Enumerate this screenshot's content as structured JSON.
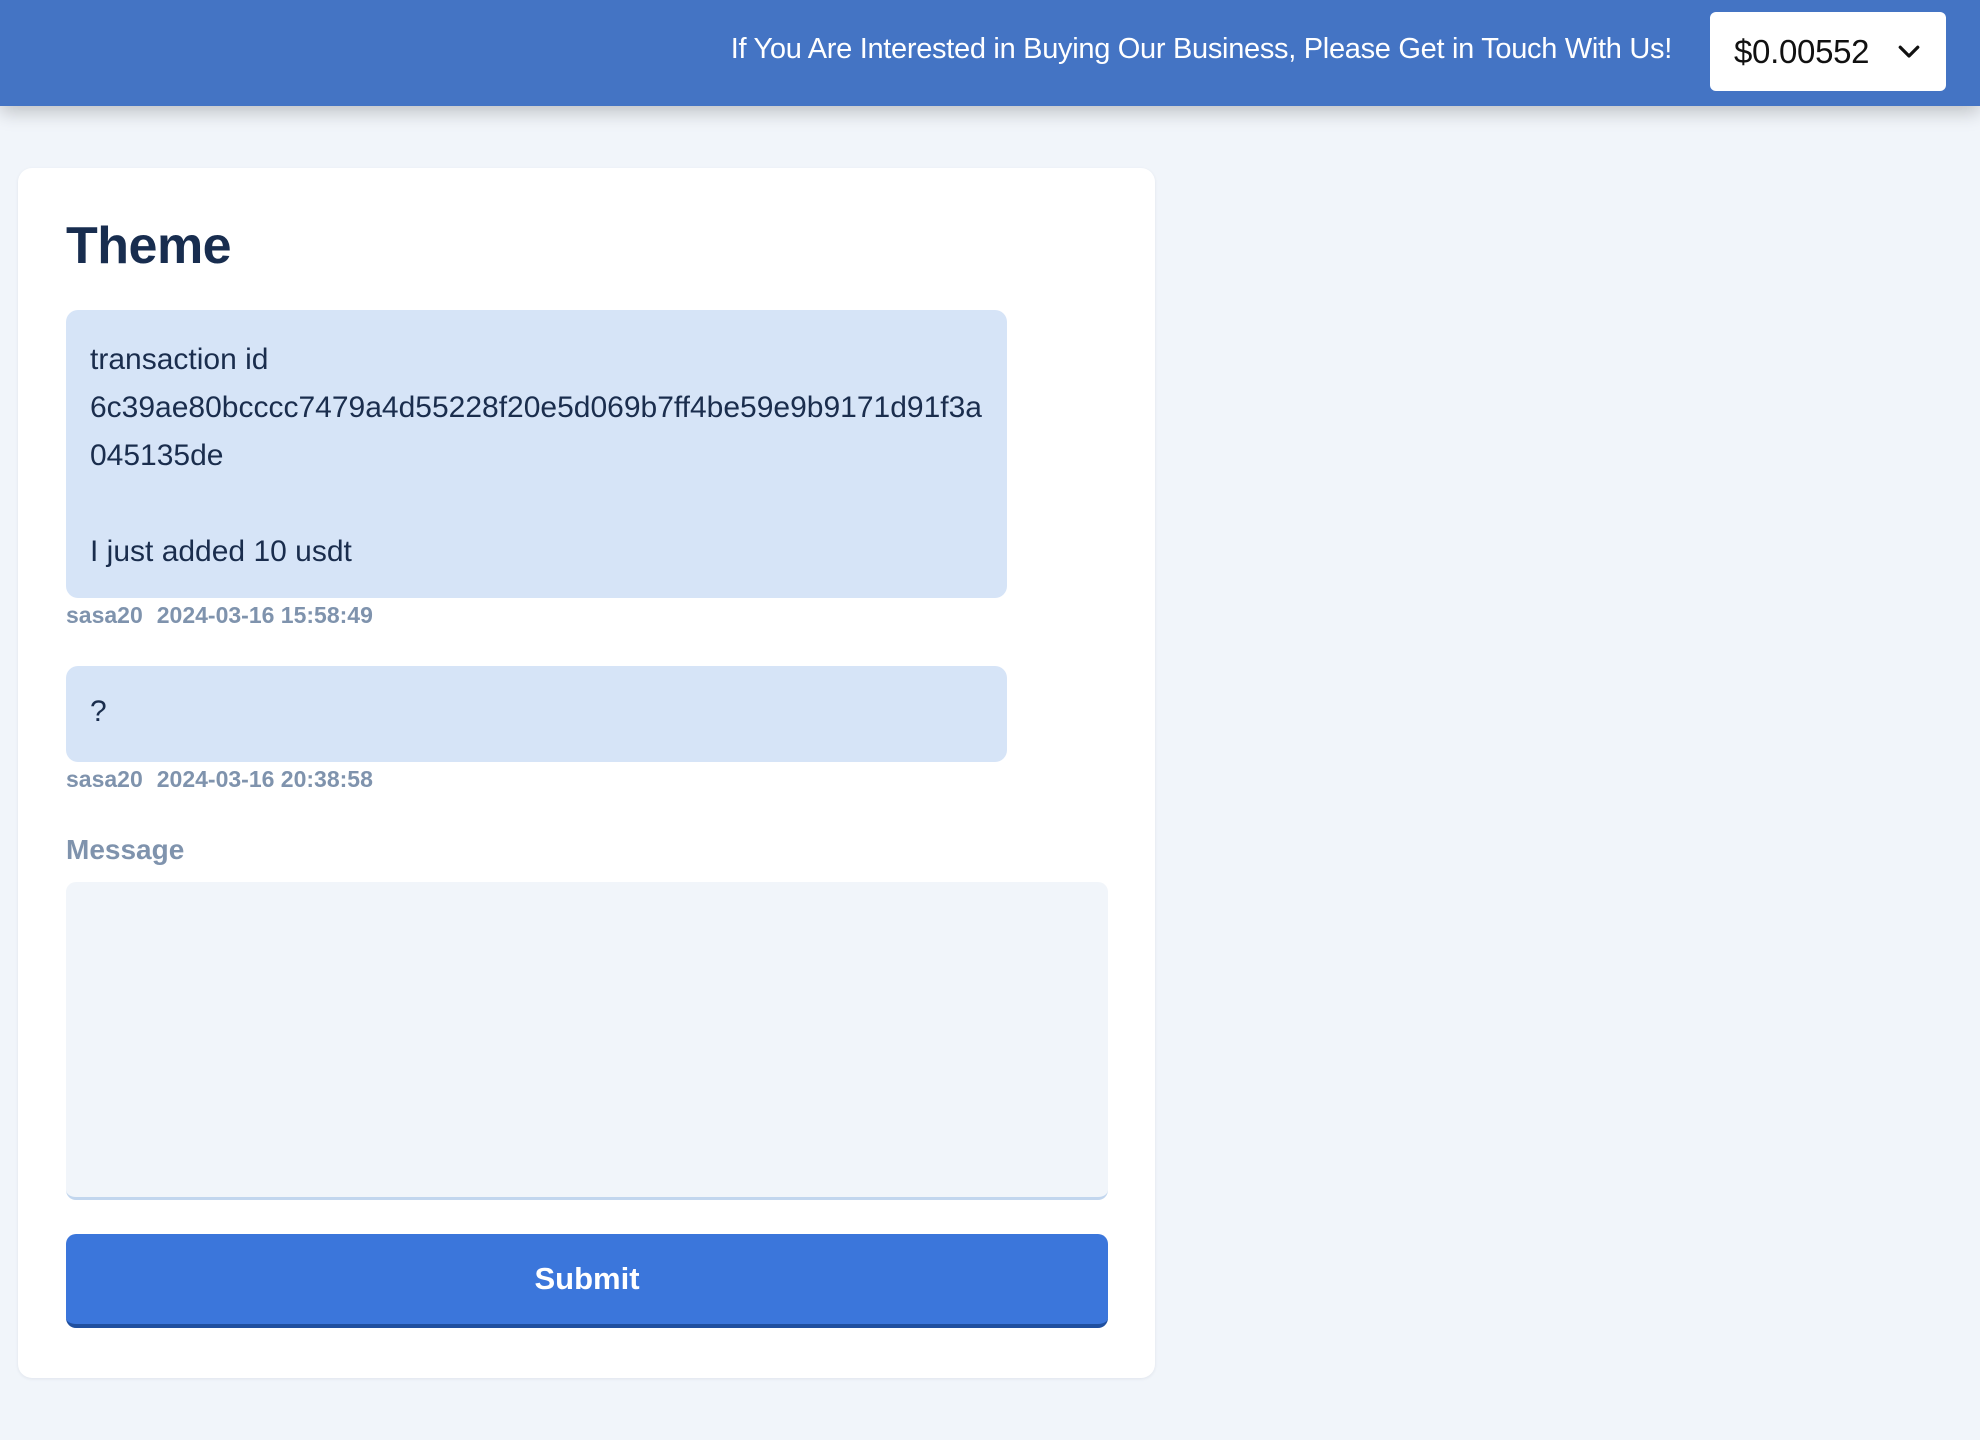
{
  "header": {
    "announcement": "If You Are Interested in Buying Our Business, Please Get in Touch With Us!",
    "price_selector": {
      "value": "$0.00552",
      "icon": "chevron-down-icon"
    }
  },
  "ticket": {
    "title": "Theme",
    "messages": [
      {
        "text": "transaction id\n6c39ae80bcccc7479a4d55228f20e5d069b7ff4be59e9b9171d91f3a045135de\n\nI just added 10 usdt",
        "author": "sasa20",
        "timestamp": "2024-03-16 15:58:49"
      },
      {
        "text": "?",
        "author": "sasa20",
        "timestamp": "2024-03-16 20:38:58"
      }
    ],
    "reply": {
      "label": "Message",
      "value": "",
      "placeholder": "",
      "submit_label": "Submit"
    }
  },
  "colors": {
    "header_bg": "#4474c4",
    "page_bg": "#f1f5fa",
    "bubble_bg": "#d6e4f7",
    "title_text": "#182d4f",
    "meta_text": "#7f93ad",
    "submit_bg": "#3b76db"
  }
}
